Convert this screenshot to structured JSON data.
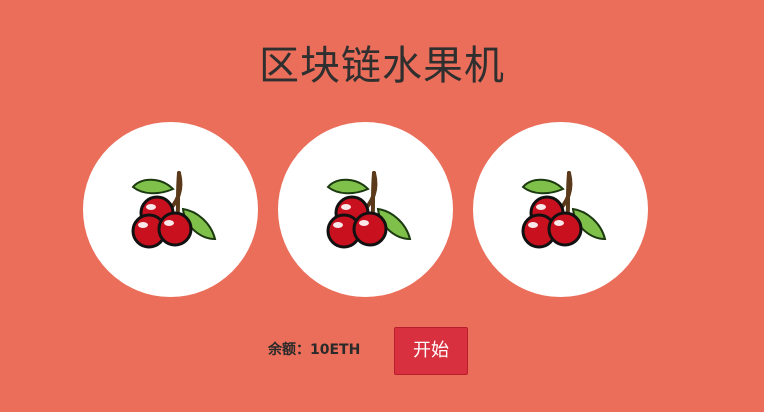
{
  "app": {
    "title": "区块链水果机"
  },
  "reels": [
    {
      "symbol": "cherry-icon"
    },
    {
      "symbol": "cherry-icon"
    },
    {
      "symbol": "cherry-icon"
    }
  ],
  "controls": {
    "balance_text": "余额：10ETH",
    "start_label": "开始"
  },
  "colors": {
    "background": "#EB6E5A",
    "reel_background": "#FFFFFF",
    "start_button": "#D9303F",
    "title_text": "#2F2F2F"
  }
}
